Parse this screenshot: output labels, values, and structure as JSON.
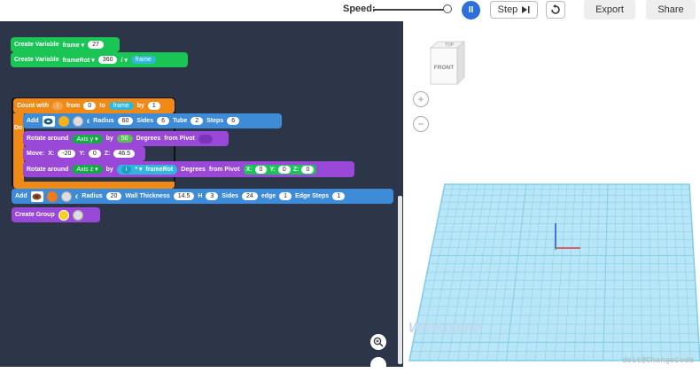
{
  "toolbar": {
    "speed_label": "Speed:",
    "run_label": "II",
    "step_label": "Step",
    "export_label": "Export",
    "share_label": "Share"
  },
  "blocks": {
    "var1": {
      "create": "Create Variable",
      "name": "frame",
      "value": "27"
    },
    "var2": {
      "create": "Create Variable",
      "name": "frameRot",
      "value": "360",
      "op": "/",
      "ref": "frame"
    },
    "loop": {
      "count": "Count with",
      "var": "i",
      "from": "from",
      "from_val": "0",
      "to": "to",
      "to_val": "frame",
      "by": "by",
      "by_val": "1",
      "do": "Do"
    },
    "add1": {
      "add": "Add",
      "radius_label": "Radius",
      "radius": "60",
      "sides_label": "Sides",
      "sides": "6",
      "tube_label": "Tube",
      "tube": "2",
      "steps_label": "Steps",
      "steps": "6"
    },
    "rot1": {
      "label": "Rotate around",
      "axis": "Axis y",
      "by": "by",
      "val": "50",
      "degrees": "Degrees",
      "pivot": "from Pivot"
    },
    "move": {
      "label": "Move:",
      "x_label": "X:",
      "x": "-20",
      "y_label": "Y:",
      "y": "0",
      "z_label": "Z:",
      "z": "46.5"
    },
    "rot2": {
      "label": "Rotate around",
      "axis": "Axis z",
      "by": "by",
      "i": "i",
      "op": "*",
      "ref": "frameRot",
      "degrees": "Degrees",
      "pivot": "from Pivot",
      "x_label": "X:",
      "x": "0",
      "y_label": "Y:",
      "y": "0",
      "z_label": "Z:",
      "z": "0"
    },
    "add2": {
      "add": "Add",
      "radius_label": "Radius",
      "radius": "20",
      "wall_label": "Wall Thickness",
      "wall": "14.5",
      "h_label": "H",
      "h": "3",
      "sides_label": "Sides",
      "sides": "24",
      "edge_label": "edge",
      "edge": "1",
      "edge_steps_label": "Edge Steps",
      "edge_steps": "1"
    },
    "group": {
      "label": "Create Group"
    }
  },
  "viewcube": {
    "top": "TOP",
    "front": "FRONT"
  },
  "zoom": {
    "in": "+",
    "out": "−"
  },
  "workplane_label": "Workplane",
  "watermark": "doit@ChangeCode",
  "colors": {
    "workspace": "#2c3648",
    "green": "#1ac455",
    "orange": "#f08a16",
    "blue": "#3e8bd8",
    "purple": "#9a48d8",
    "grid": "#9fdcf0"
  }
}
